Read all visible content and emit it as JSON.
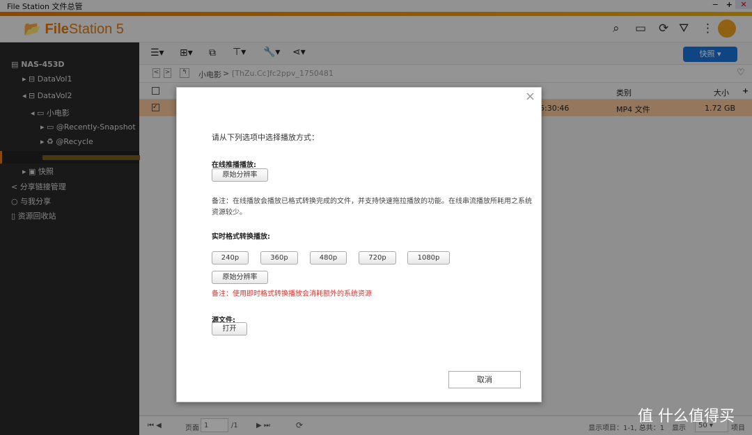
{
  "window": {
    "title": "File Station 文件总管",
    "minimize": "−",
    "maximize": "+",
    "close": "✕"
  },
  "header": {
    "logo_bold": "File",
    "logo_rest": "Station 5",
    "icons": [
      "search-icon",
      "cast-icon",
      "refresh-icon",
      "filter-icon",
      "more-icon",
      "snapshot-circle-icon"
    ]
  },
  "sidebar": {
    "items": [
      {
        "label": "NAS-453D"
      },
      {
        "label": "DataVol1"
      },
      {
        "label": "DataVol2"
      },
      {
        "label": "小电影"
      },
      {
        "label": "@Recently-Snapshot"
      },
      {
        "label": "@Recycle"
      },
      {
        "label": "快照"
      },
      {
        "label": "分享链接管理"
      },
      {
        "label": "与我分享"
      },
      {
        "label": "资源回收站"
      }
    ]
  },
  "toolbar": {
    "snapshot_button": "快照 ▾"
  },
  "path": {
    "parent": "小电影",
    "separator": ">",
    "current": "[ThZu.Cc]fc2ppv_1750481"
  },
  "table": {
    "columns": {
      "type": "类别",
      "size": "大小",
      "add": "+"
    },
    "rows": [
      {
        "modified": "5:30:46",
        "type": "MP4 文件",
        "size": "1.72 GB",
        "checked": true
      }
    ]
  },
  "footer": {
    "page_label": "页面",
    "page_value": "1",
    "page_total": "/1",
    "display_items": "显示项目：1-1, 总共：1",
    "show": "显示",
    "per_page": "50",
    "items": "项目"
  },
  "dialog": {
    "close": "×",
    "prompt": "请从下列选项中选择播放方式：",
    "online_label": "在线推播播放:",
    "original_resolution": "原始分辨率",
    "online_note": "备注：在线播放会播放已格式转换完成的文件，并支持快速拖拉播放的功能。在线串流播放所耗用之系统资源较少。",
    "realtime_label": "实时格式转换播放:",
    "resolutions": [
      "240p",
      "360p",
      "480p",
      "720p",
      "1080p"
    ],
    "realtime_original": "原始分辨率",
    "realtime_note": "备注：使用即时格式转换播放会消耗额外的系统资源",
    "source_label": "源文件:",
    "open": "打开",
    "cancel": "取消"
  },
  "watermark": "值 什么值得买",
  "colors": {
    "accent": "#e07a10",
    "note_red": "#e8302a",
    "snapshot_blue": "#1a73d9",
    "selected_row": "#f7c79a"
  }
}
